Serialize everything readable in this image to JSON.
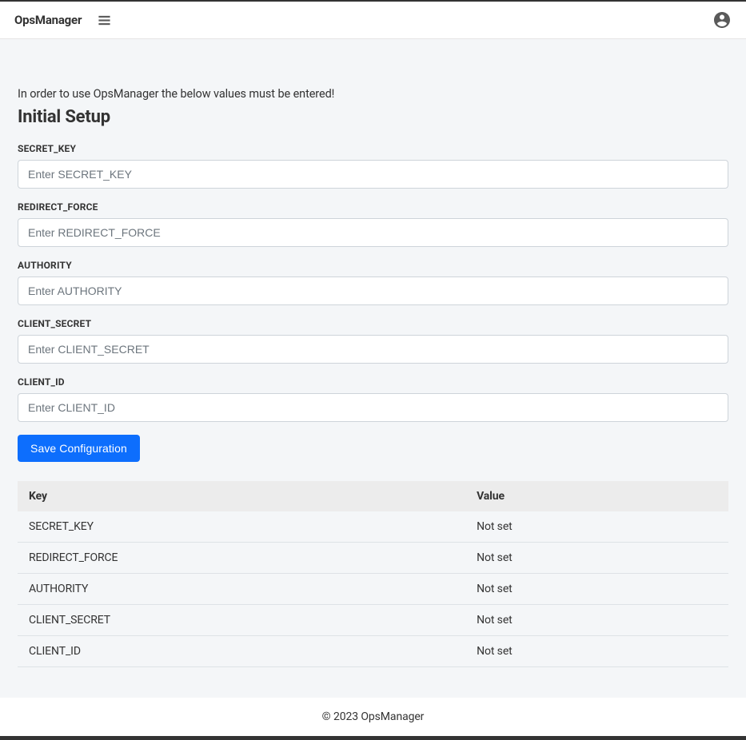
{
  "navbar": {
    "brand": "OpsManager"
  },
  "page": {
    "intro": "In order to use OpsManager the below values must be entered!",
    "title": "Initial Setup"
  },
  "form": {
    "fields": [
      {
        "label": "SECRET_KEY",
        "placeholder": "Enter SECRET_KEY"
      },
      {
        "label": "REDIRECT_FORCE",
        "placeholder": "Enter REDIRECT_FORCE"
      },
      {
        "label": "AUTHORITY",
        "placeholder": "Enter AUTHORITY"
      },
      {
        "label": "CLIENT_SECRET",
        "placeholder": "Enter CLIENT_SECRET"
      },
      {
        "label": "CLIENT_ID",
        "placeholder": "Enter CLIENT_ID"
      }
    ],
    "save_label": "Save Configuration"
  },
  "table": {
    "headers": {
      "key": "Key",
      "value": "Value"
    },
    "rows": [
      {
        "key": "SECRET_KEY",
        "value": "Not set"
      },
      {
        "key": "REDIRECT_FORCE",
        "value": "Not set"
      },
      {
        "key": "AUTHORITY",
        "value": "Not set"
      },
      {
        "key": "CLIENT_SECRET",
        "value": "Not set"
      },
      {
        "key": "CLIENT_ID",
        "value": "Not set"
      }
    ]
  },
  "footer": {
    "text": "© 2023 OpsManager"
  }
}
